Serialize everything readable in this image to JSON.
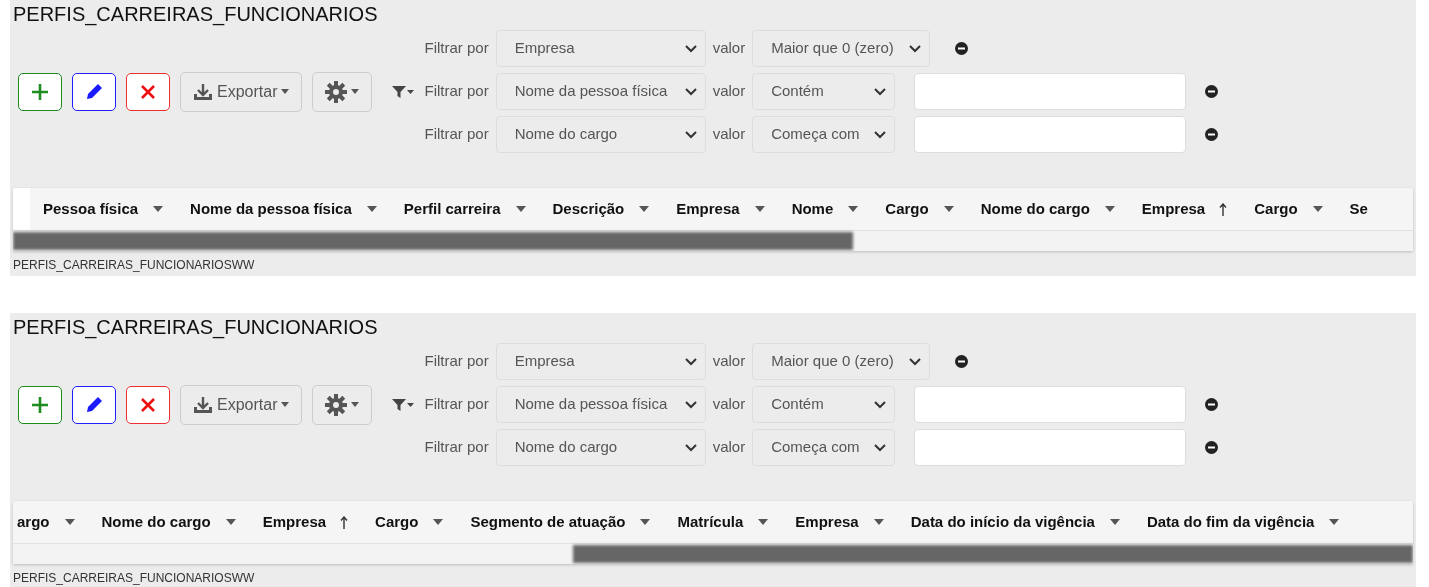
{
  "panels": [
    {
      "title": "PERFIS_CARREIRAS_FUNCIONARIOS",
      "export_label": "Exportar",
      "filters": [
        {
          "kind": "select-only",
          "label": "Filtrar por",
          "field": "Empresa",
          "value_label": "valor",
          "operator": "Maior que 0 (zero)"
        },
        {
          "kind": "with-input",
          "label": "Filtrar por",
          "field": "Nome da pessoa física",
          "value_label": "valor",
          "operator": "Contém"
        },
        {
          "kind": "with-input",
          "label": "Filtrar por",
          "field": "Nome do cargo",
          "value_label": "valor",
          "operator": "Começa com"
        }
      ],
      "columns": [
        {
          "label": "Pessoa física",
          "sorted": false
        },
        {
          "label": "Nome da pessoa física",
          "sorted": false
        },
        {
          "label": "Perfil carreira",
          "sorted": false
        },
        {
          "label": "Descrição",
          "sorted": false
        },
        {
          "label": "Empresa",
          "sorted": false
        },
        {
          "label": "Nome",
          "sorted": false
        },
        {
          "label": "Cargo",
          "sorted": false
        },
        {
          "label": "Nome do cargo",
          "sorted": false
        },
        {
          "label": "Empresa",
          "sorted": true
        },
        {
          "label": "Cargo",
          "sorted": false
        },
        {
          "label": "Se"
        }
      ],
      "scrolled_to_end": false,
      "footer": "PERFIS_CARREIRAS_FUNCIONARIOSWW"
    },
    {
      "title": "PERFIS_CARREIRAS_FUNCIONARIOS",
      "export_label": "Exportar",
      "filters": [
        {
          "kind": "select-only",
          "label": "Filtrar por",
          "field": "Empresa",
          "value_label": "valor",
          "operator": "Maior que 0 (zero)"
        },
        {
          "kind": "with-input",
          "label": "Filtrar por",
          "field": "Nome da pessoa física",
          "value_label": "valor",
          "operator": "Contém"
        },
        {
          "kind": "with-input",
          "label": "Filtrar por",
          "field": "Nome do cargo",
          "value_label": "valor",
          "operator": "Começa com"
        }
      ],
      "columns": [
        {
          "label": "argo",
          "sorted": false
        },
        {
          "label": "Nome do cargo",
          "sorted": false
        },
        {
          "label": "Empresa",
          "sorted": true
        },
        {
          "label": "Cargo",
          "sorted": false
        },
        {
          "label": "Segmento de atuação",
          "sorted": false
        },
        {
          "label": "Matrícula",
          "sorted": false
        },
        {
          "label": "Empresa",
          "sorted": false
        },
        {
          "label": "Data do início da vigência",
          "sorted": false
        },
        {
          "label": "Data do fim da vigência",
          "sorted": false
        }
      ],
      "scrolled_to_end": true,
      "footer": "PERFIS_CARREIRAS_FUNCIONARIOSWW"
    }
  ]
}
